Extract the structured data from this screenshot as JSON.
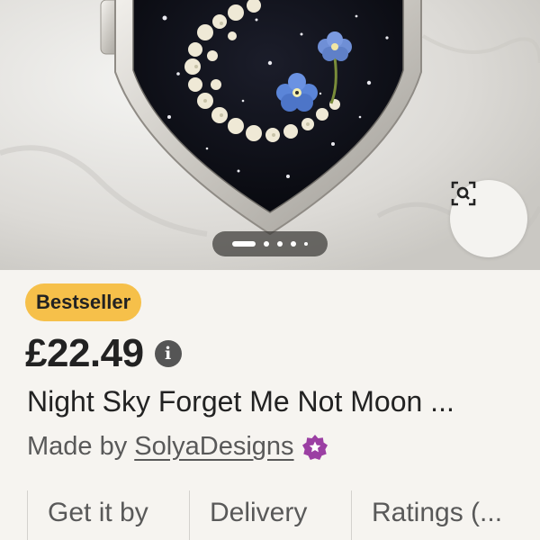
{
  "product_image": {
    "alt": "Pressed flower moon pendant",
    "carousel_dots": 5,
    "active_index": 0
  },
  "listing": {
    "badge": "Bestseller",
    "price": "£22.49",
    "title": "Night Sky Forget Me Not Moon ...",
    "made_by_prefix": "Made by",
    "shop_name": "SolyaDesigns"
  },
  "tabs": [
    {
      "label": "Get it by"
    },
    {
      "label": "Delivery"
    },
    {
      "label": "Ratings (..."
    }
  ],
  "colors": {
    "badge_bg": "#f6c04a",
    "star_seller": "#9b3fa3",
    "text": "#222222",
    "muted_text": "#595959"
  },
  "icons": {
    "visual_search": "visual-search-icon",
    "info": "info-icon",
    "star_seller": "star-seller-icon"
  }
}
